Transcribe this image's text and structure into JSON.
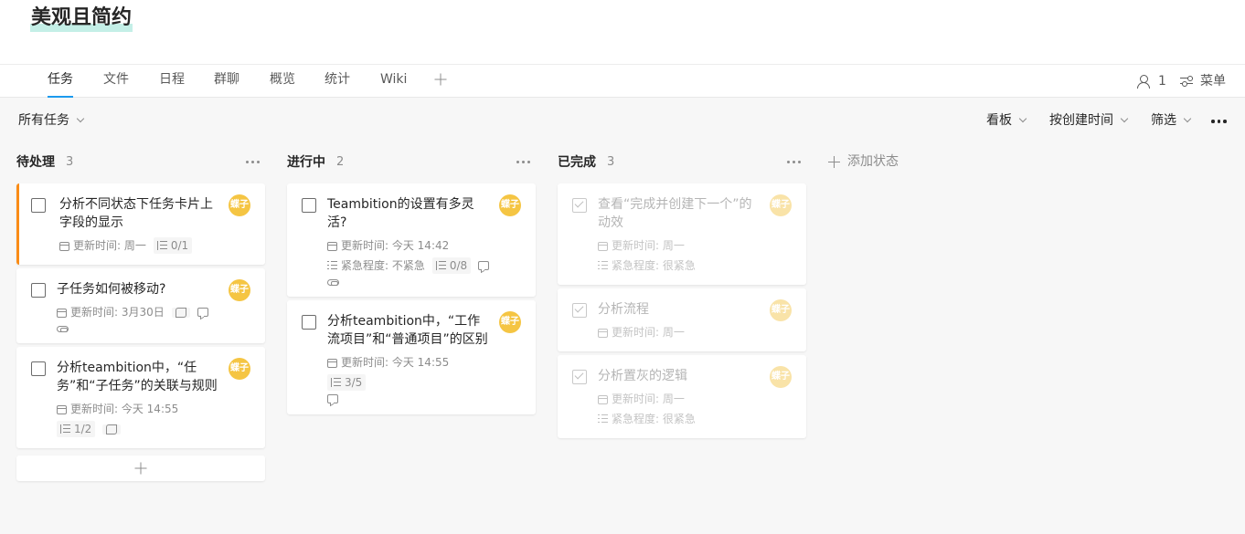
{
  "page_title": "美观且简约",
  "tabs": [
    "任务",
    "文件",
    "日程",
    "群聊",
    "概览",
    "统计",
    "Wiki"
  ],
  "active_tab": "任务",
  "header_right": {
    "members_count": "1",
    "menu_label": "菜单"
  },
  "toolbar": {
    "filter_scope": "所有任务",
    "view": "看板",
    "sort": "按创建时间",
    "filter": "筛选"
  },
  "columns": [
    {
      "name": "待处理",
      "count": "3",
      "cards": [
        {
          "title": "分析不同状态下任务卡片上字段的显示",
          "assignee": "蝶子",
          "updated": "更新时间: 周一",
          "subtasks": "0/1",
          "priority_marker": "#fa8c16"
        },
        {
          "title": "子任务如何被移动?",
          "assignee": "蝶子",
          "updated": "更新时间: 3月30日"
        },
        {
          "title": "分析teambition中，“任务”和“子任务”的关联与规则",
          "assignee": "蝶子",
          "updated": "更新时间: 今天 14:55",
          "subtasks": "1/2"
        }
      ]
    },
    {
      "name": "进行中",
      "count": "2",
      "cards": [
        {
          "title": "Teambition的设置有多灵活?",
          "assignee": "蝶子",
          "updated": "更新时间: 今天 14:42",
          "urgency": "紧急程度: 不紧急",
          "subtasks": "0/8"
        },
        {
          "title": "分析teambition中，“工作流项目”和“普通项目”的区别",
          "assignee": "蝶子",
          "updated": "更新时间: 今天 14:55",
          "subtasks": "3/5"
        }
      ]
    },
    {
      "name": "已完成",
      "count": "3",
      "cards": [
        {
          "title": "查看“完成并创建下一个”的动效",
          "assignee": "蝶子",
          "updated": "更新时间: 周一",
          "urgency": "紧急程度: 很紧急"
        },
        {
          "title": "分析流程",
          "assignee": "蝶子",
          "updated": "更新时间: 周一"
        },
        {
          "title": "分析置灰的逻辑",
          "assignee": "蝶子",
          "updated": "更新时间: 周一",
          "urgency": "紧急程度: 很紧急"
        }
      ]
    }
  ],
  "add_status_label": "添加状态",
  "icons": [
    "calendar-icon",
    "subtask-icon",
    "list-icon",
    "comment-icon",
    "attachment-icon",
    "repeat-icon",
    "plus-icon",
    "person-icon",
    "sliders-icon",
    "more-icon"
  ]
}
